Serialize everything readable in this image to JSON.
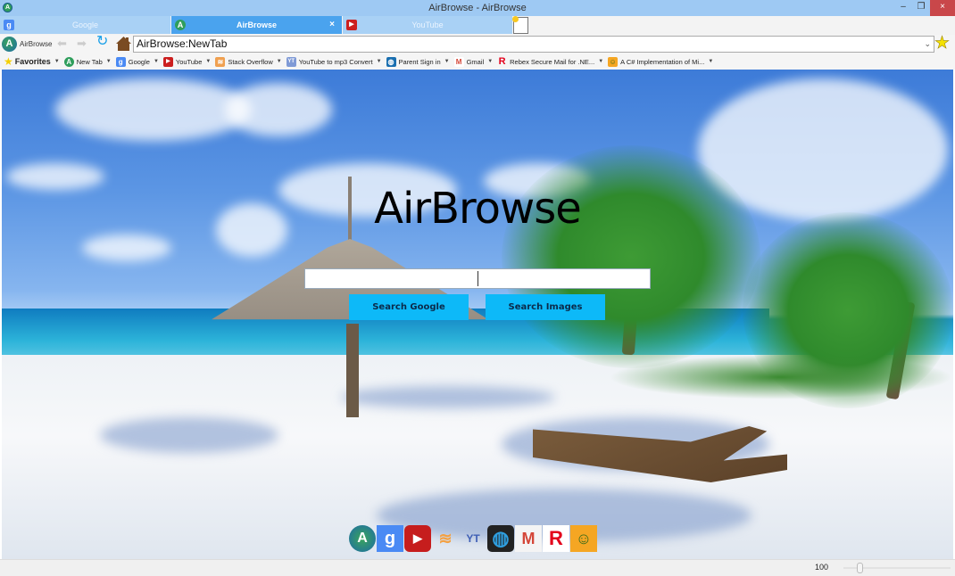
{
  "window": {
    "title": "AirBrowse - AirBrowse",
    "controls": {
      "minimize": "–",
      "maximize": "❐",
      "close": "×"
    }
  },
  "tabs": [
    {
      "label": "Google",
      "icon": "google-icon",
      "active": false
    },
    {
      "label": "AirBrowse",
      "icon": "airbrowse-icon",
      "active": true,
      "close": "×"
    },
    {
      "label": "YouTube",
      "icon": "youtube-icon",
      "active": false
    }
  ],
  "nav": {
    "brand": "AirBrowse",
    "back": "⬅",
    "forward": "➡",
    "reload": "↻",
    "address": "AirBrowse:NewTab",
    "address_dropdown": "⌄",
    "favorite_star": "★"
  },
  "favorites": {
    "title": "Favorites",
    "items": [
      {
        "label": "New Tab",
        "icon": "airbrowse-icon"
      },
      {
        "label": "Google",
        "icon": "google-icon"
      },
      {
        "label": "YouTube",
        "icon": "youtube-icon"
      },
      {
        "label": "Stack Overflow",
        "icon": "stackoverflow-icon"
      },
      {
        "label": "YouTube to mp3 Convert",
        "icon": "ytmp3-icon"
      },
      {
        "label": "Parent Sign in",
        "icon": "globe-icon"
      },
      {
        "label": "Gmail",
        "icon": "gmail-icon"
      },
      {
        "label": "Rebex Secure Mail for .NE...",
        "icon": "rebex-icon"
      },
      {
        "label": "A C# Implementation of Mi...",
        "icon": "android-icon"
      }
    ]
  },
  "newtab": {
    "heading": "AirBrowse",
    "search_value": "",
    "search_google": "Search Google",
    "search_images": "Search Images",
    "dock": [
      {
        "name": "airbrowse-icon",
        "glyph": "A",
        "color": "#2f9e5c"
      },
      {
        "name": "google-icon",
        "glyph": "g",
        "color": "#4a8af4"
      },
      {
        "name": "youtube-icon",
        "glyph": "▶",
        "color": "#cc1f1f"
      },
      {
        "name": "stackoverflow-icon",
        "glyph": "≋",
        "color": "#f48024"
      },
      {
        "name": "ytmp3-icon",
        "glyph": "YT",
        "color": "#3f5fb5"
      },
      {
        "name": "globe-icon",
        "glyph": "◍",
        "color": "#1a6fb0"
      },
      {
        "name": "gmail-icon",
        "glyph": "M",
        "color": "#d44638"
      },
      {
        "name": "rebex-icon",
        "glyph": "R",
        "color": "#e3001b"
      },
      {
        "name": "android-icon",
        "glyph": "☺",
        "color": "#f5a623"
      }
    ]
  },
  "status": {
    "zoom": "100",
    "zoom_level": 0.15
  }
}
